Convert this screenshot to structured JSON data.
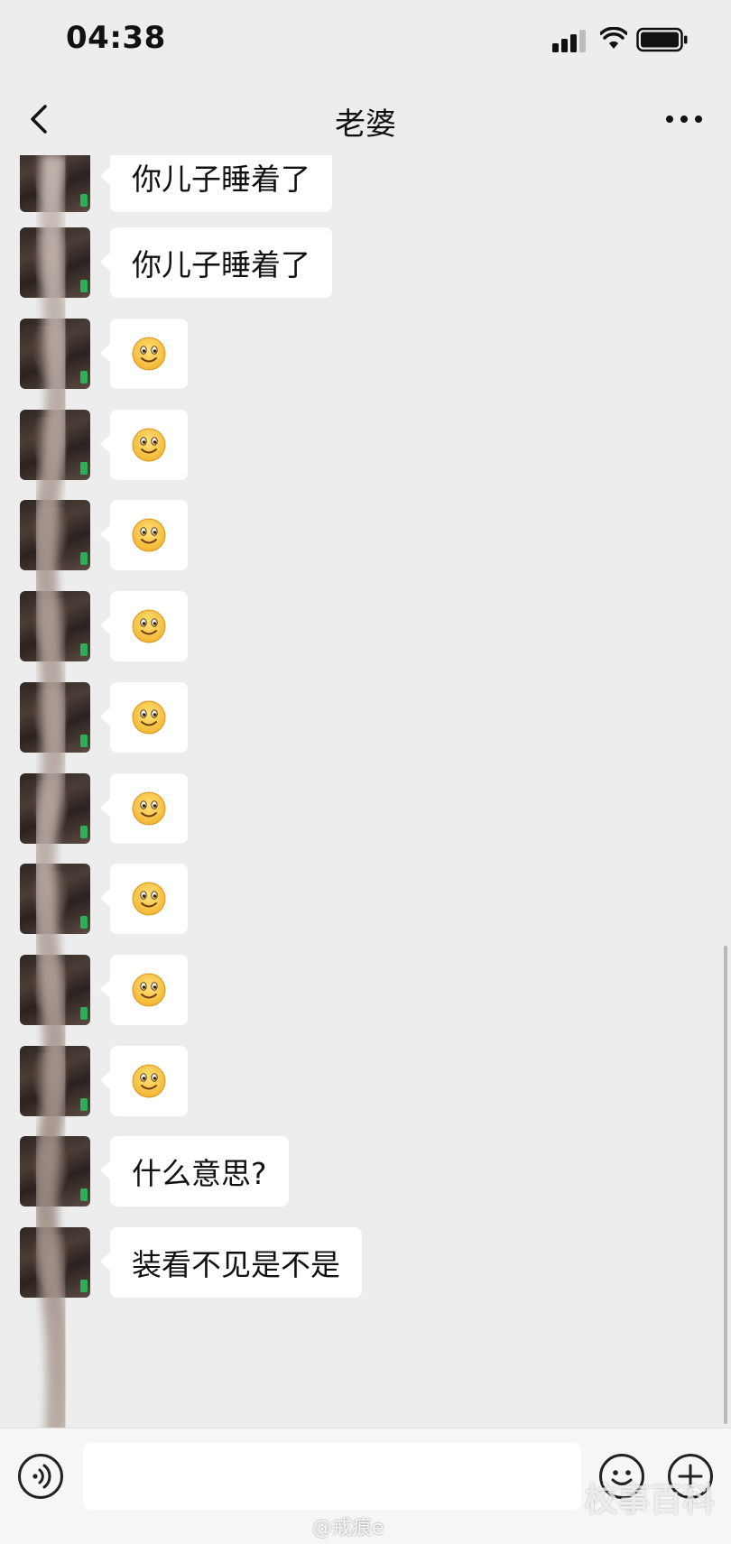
{
  "status_bar": {
    "time": "04:38"
  },
  "nav": {
    "title": "老婆",
    "back_icon": "chevron-left-icon",
    "more_icon": "more-dots-icon"
  },
  "messages": [
    {
      "sender": "contact",
      "type": "text",
      "text": "你儿子睡着了"
    },
    {
      "sender": "contact",
      "type": "text",
      "text": "你儿子睡着了"
    },
    {
      "sender": "contact",
      "type": "emoji",
      "text": "🙂"
    },
    {
      "sender": "contact",
      "type": "emoji",
      "text": "🙂"
    },
    {
      "sender": "contact",
      "type": "emoji",
      "text": "🙂"
    },
    {
      "sender": "contact",
      "type": "emoji",
      "text": "🙂"
    },
    {
      "sender": "contact",
      "type": "emoji",
      "text": "🙂"
    },
    {
      "sender": "contact",
      "type": "emoji",
      "text": "🙂"
    },
    {
      "sender": "contact",
      "type": "emoji",
      "text": "🙂"
    },
    {
      "sender": "contact",
      "type": "emoji",
      "text": "🙂"
    },
    {
      "sender": "contact",
      "type": "emoji",
      "text": "🙂"
    },
    {
      "sender": "contact",
      "type": "text",
      "text": "什么意思?"
    },
    {
      "sender": "contact",
      "type": "text",
      "text": "装看不见是不是"
    }
  ],
  "input_bar": {
    "value": "",
    "voice_icon": "voice-icon",
    "emoji_icon": "emoji-icon",
    "add_icon": "plus-icon"
  },
  "watermarks": {
    "weibo": "@戒痕e",
    "logo": "校事百科"
  },
  "colors": {
    "background": "#ededed",
    "bubble": "#ffffff",
    "input_bar": "#f6f6f6"
  }
}
